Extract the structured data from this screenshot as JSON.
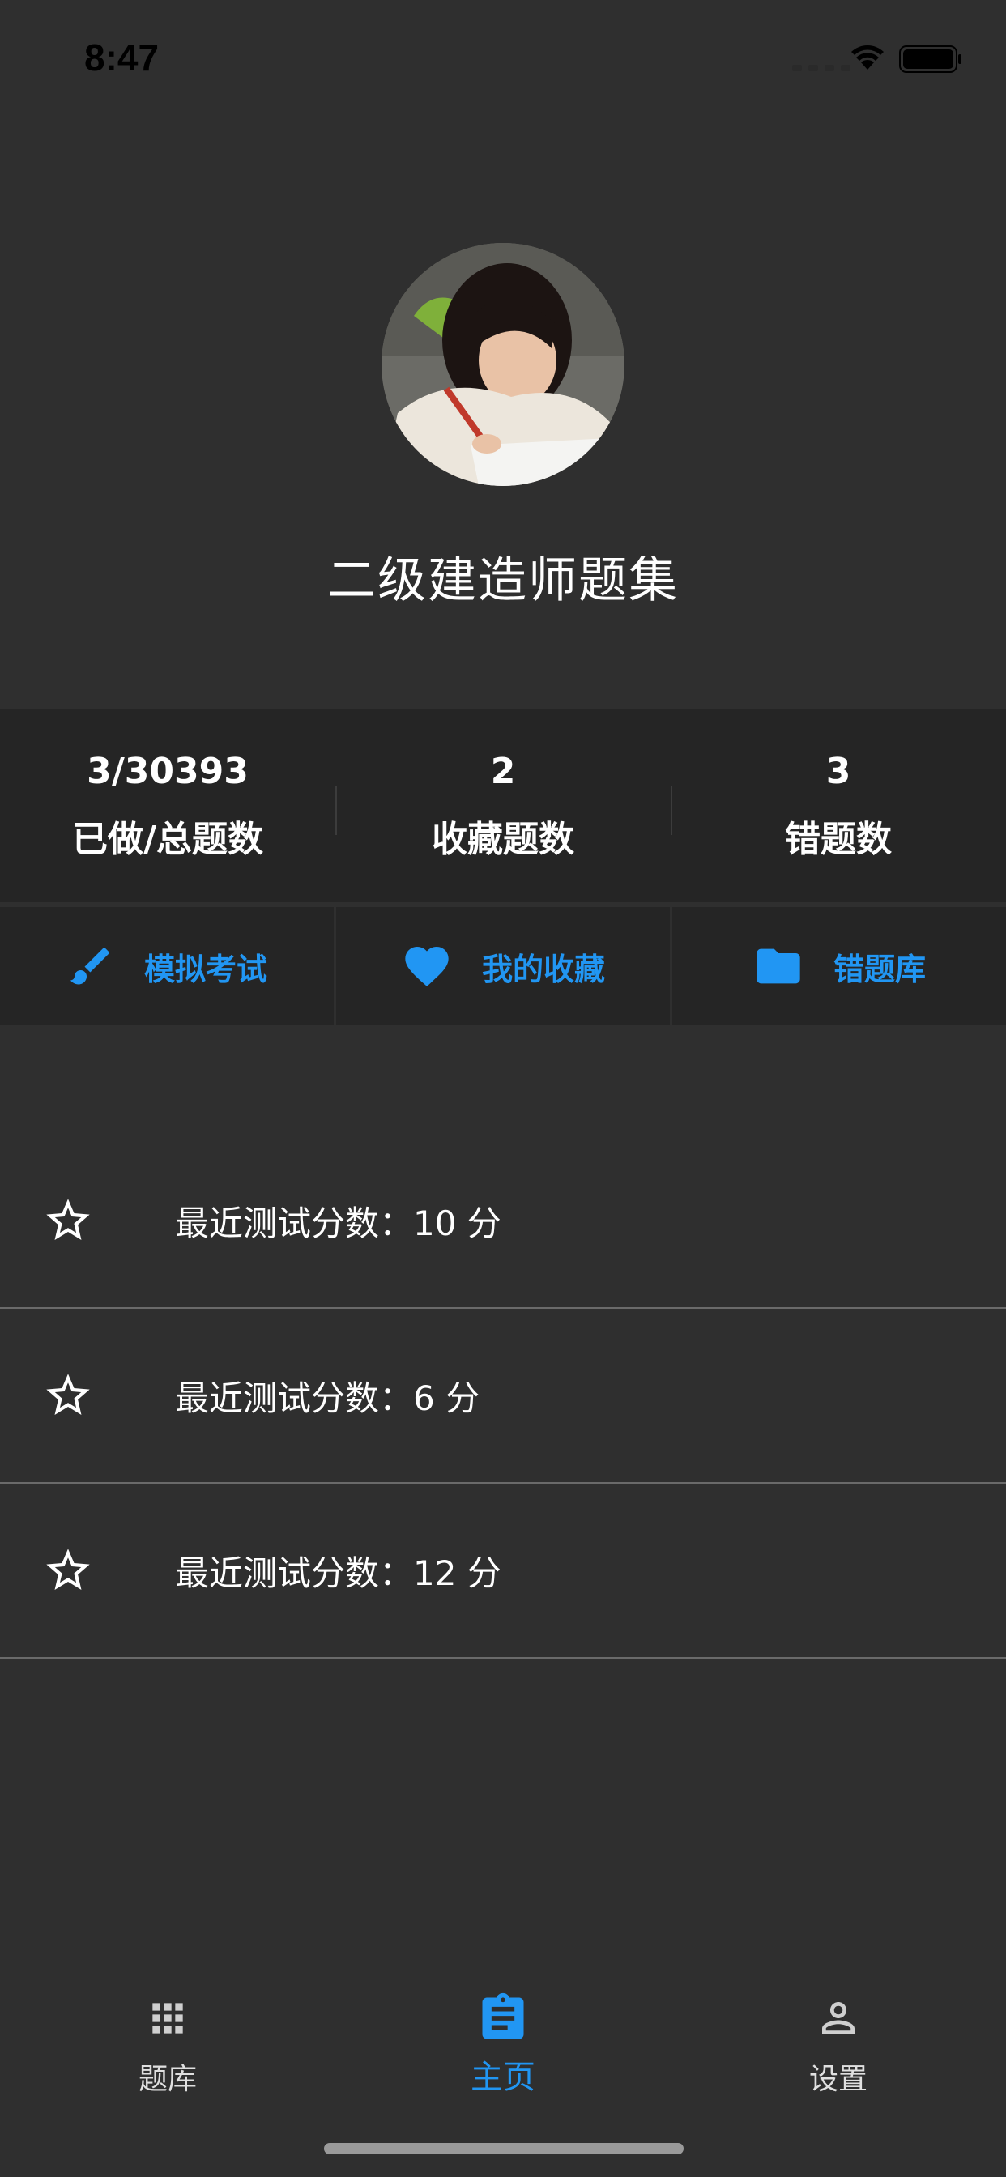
{
  "status_bar": {
    "time": "8:47"
  },
  "header": {
    "avatar_icon": "avatar-photo",
    "title": "二级建造师题集"
  },
  "stats": [
    {
      "value": "3/30393",
      "label": "已做/总题数"
    },
    {
      "value": "2",
      "label": "收藏题数"
    },
    {
      "value": "3",
      "label": "错题数"
    }
  ],
  "actions": [
    {
      "label": "模拟考试",
      "icon": "brush-icon"
    },
    {
      "label": "我的收藏",
      "icon": "heart-icon"
    },
    {
      "label": "错题库",
      "icon": "folder-icon"
    }
  ],
  "scores": [
    {
      "text": "最近测试分数：10 分",
      "icon": "star-outline-icon"
    },
    {
      "text": "最近测试分数：6 分",
      "icon": "star-outline-icon"
    },
    {
      "text": "最近测试分数：12 分",
      "icon": "star-outline-icon"
    }
  ],
  "tabs": [
    {
      "label": "题库",
      "icon": "grid-icon",
      "active": false
    },
    {
      "label": "主页",
      "icon": "clipboard-icon",
      "active": true
    },
    {
      "label": "设置",
      "icon": "person-icon",
      "active": false
    }
  ],
  "colors": {
    "background": "#2f2f2f",
    "panel": "#252525",
    "accent": "#2196f3",
    "text": "#ffffff"
  }
}
